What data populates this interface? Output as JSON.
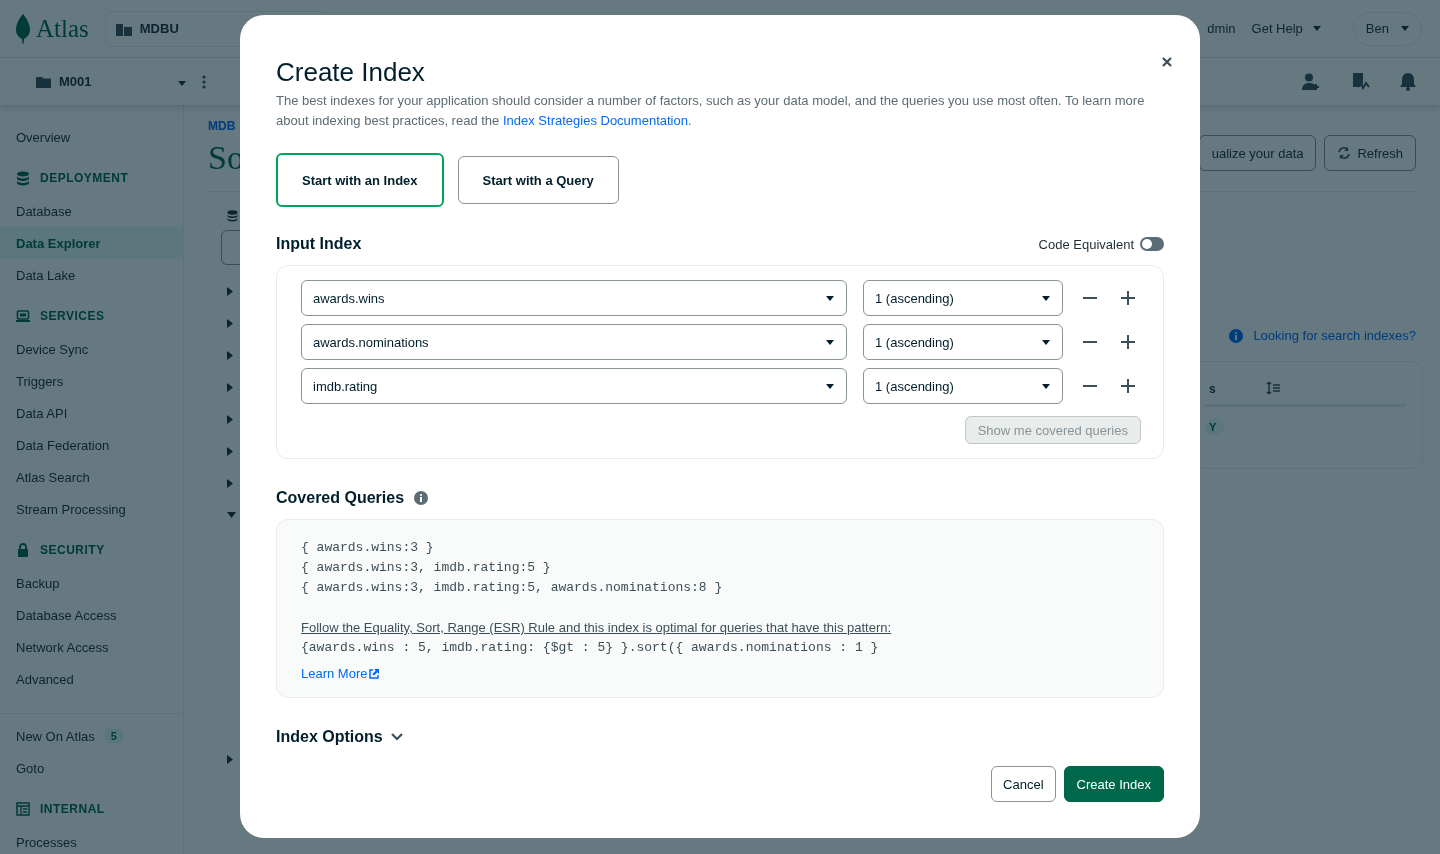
{
  "header": {
    "logo": "Atlas",
    "organization": "MDBU",
    "admin_fragment": "dmin",
    "help": "Get Help",
    "user": "Ben"
  },
  "subheader": {
    "project": "M001"
  },
  "sidebar": {
    "items": [
      {
        "kind": "item",
        "label": "Overview",
        "selected": false
      },
      {
        "kind": "section",
        "label": "DEPLOYMENT"
      },
      {
        "kind": "item",
        "label": "Database",
        "selected": false
      },
      {
        "kind": "item",
        "label": "Data Explorer",
        "selected": true
      },
      {
        "kind": "item",
        "label": "Data Lake",
        "selected": false
      },
      {
        "kind": "section",
        "label": "SERVICES"
      },
      {
        "kind": "item",
        "label": "Device Sync",
        "selected": false
      },
      {
        "kind": "item",
        "label": "Triggers",
        "selected": false
      },
      {
        "kind": "item",
        "label": "Data API",
        "selected": false
      },
      {
        "kind": "item",
        "label": "Data Federation",
        "selected": false
      },
      {
        "kind": "item",
        "label": "Atlas Search",
        "selected": false
      },
      {
        "kind": "item",
        "label": "Stream Processing",
        "selected": false
      },
      {
        "kind": "section",
        "label": "SECURITY"
      },
      {
        "kind": "item",
        "label": "Backup",
        "selected": false
      },
      {
        "kind": "item",
        "label": "Database Access",
        "selected": false
      },
      {
        "kind": "item",
        "label": "Network Access",
        "selected": false
      },
      {
        "kind": "item",
        "label": "Advanced",
        "selected": false
      },
      {
        "kind": "divider"
      },
      {
        "kind": "item",
        "label": "New On Atlas",
        "selected": false,
        "badge": "5"
      },
      {
        "kind": "item",
        "label": "Goto",
        "selected": false
      },
      {
        "kind": "section",
        "label": "INTERNAL"
      },
      {
        "kind": "item",
        "label": "Processes",
        "selected": false
      }
    ]
  },
  "main": {
    "breadcrumb": "MDB",
    "title": "So",
    "visualize_button": "ualize your data",
    "refresh_button": "Refresh",
    "search_indexes_link": "Looking for search indexes?",
    "table_header": "s",
    "status_badge": "Y"
  },
  "modal": {
    "title": "Create Index",
    "description": "The best indexes for your application should consider a number of factors, such as your data model, and the queries you use most often. To learn more about indexing best practices, read the ",
    "description_link": "Index Strategies Documentation",
    "description_end": ".",
    "modes": [
      {
        "label": "Start with an Index",
        "selected": true
      },
      {
        "label": "Start with a Query",
        "selected": false
      }
    ],
    "input_index": {
      "title": "Input Index",
      "code_equivalent": {
        "label": "Code Equivalent",
        "on": false
      },
      "fields": [
        {
          "field": "awards.wins",
          "direction": "1 (ascending)"
        },
        {
          "field": "awards.nominations",
          "direction": "1 (ascending)"
        },
        {
          "field": "imdb.rating",
          "direction": "1 (ascending)"
        }
      ],
      "covered_button": {
        "label": "Show me covered queries",
        "disabled": true
      }
    },
    "covered_queries": {
      "title": "Covered Queries",
      "queries": [
        "{ awards.wins:3 }",
        "{ awards.wins:3, imdb.rating:5 }",
        "{ awards.wins:3, imdb.rating:5, awards.nominations:8 }"
      ],
      "rule": "Follow the Equality, Sort, Range (ESR) Rule and this index is optimal for queries that have this pattern:",
      "pattern": "{awards.wins : 5, imdb.rating: {$gt : 5} }.sort({ awards.nominations : 1 }",
      "learn_more": "Learn More"
    },
    "index_options": {
      "label": "Index Options",
      "expanded": false
    },
    "buttons": {
      "cancel": "Cancel",
      "create": "Create Index"
    }
  }
}
